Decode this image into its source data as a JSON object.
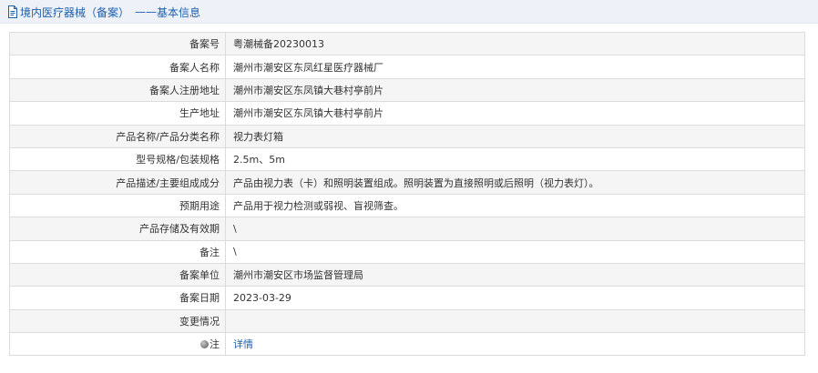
{
  "header": {
    "title": "境内医疗器械（备案）",
    "separator": "——",
    "subtitle": "基本信息",
    "icon": "document-icon"
  },
  "rows": [
    {
      "label": "备案号",
      "value": "粤潮械备20230013"
    },
    {
      "label": "备案人名称",
      "value": "潮州市潮安区东凤红星医疗器械厂"
    },
    {
      "label": "备案人注册地址",
      "value": "潮州市潮安区东凤镇大巷村亭前片"
    },
    {
      "label": "生产地址",
      "value": "潮州市潮安区东凤镇大巷村亭前片"
    },
    {
      "label": "产品名称/产品分类名称",
      "value": "视力表灯箱"
    },
    {
      "label": "型号规格/包装规格",
      "value": "2.5m、5m"
    },
    {
      "label": "产品描述/主要组成成分",
      "value": "产品由视力表（卡）和照明装置组成。照明装置为直接照明或后照明（视力表灯）。"
    },
    {
      "label": "预期用途",
      "value": "产品用于视力检测或弱视、盲视筛查。"
    },
    {
      "label": "产品存储及有效期",
      "value": "\\"
    },
    {
      "label": "备注",
      "value": "\\"
    },
    {
      "label": "备案单位",
      "value": "潮州市潮安区市场监督管理局"
    },
    {
      "label": "备案日期",
      "value": "2023-03-29"
    },
    {
      "label": "变更情况",
      "value": ""
    }
  ],
  "note_row": {
    "label": "注",
    "icon": "note-bullet-icon",
    "link_text": "详情"
  },
  "colors": {
    "header_bg": "#eef1f7",
    "link": "#1d5fae",
    "row_alt_bg": "#f5f5f5",
    "border": "#dcdcdc"
  }
}
